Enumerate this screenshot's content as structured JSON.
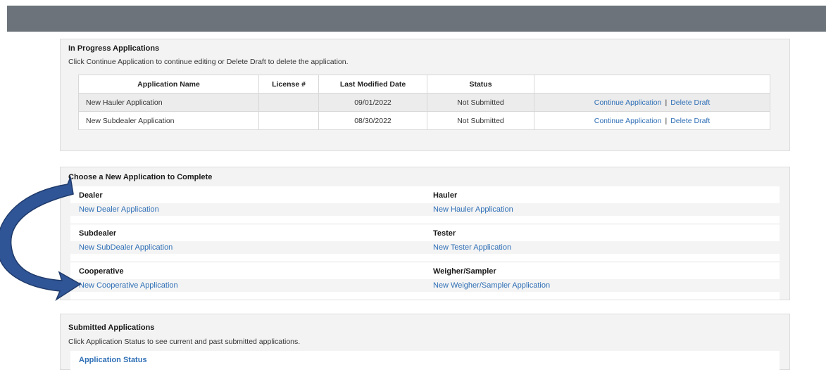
{
  "in_progress": {
    "title": "In Progress Applications",
    "description": "Click Continue Application to continue editing or Delete Draft to delete the application.",
    "columns": [
      "Application Name",
      "License #",
      "Last Modified Date",
      "Status",
      ""
    ],
    "rows": [
      {
        "name": "New Hauler Application",
        "license": "",
        "date": "09/01/2022",
        "status": "Not Submitted",
        "continue": "Continue Application",
        "separator": "|",
        "delete": "Delete Draft"
      },
      {
        "name": "New Subdealer Application",
        "license": "",
        "date": "08/30/2022",
        "status": "Not Submitted",
        "continue": "Continue Application",
        "separator": "|",
        "delete": "Delete Draft"
      }
    ]
  },
  "choose_new": {
    "title": "Choose a New Application to Complete",
    "groups": [
      {
        "left_name": "Dealer",
        "left_link": "New Dealer Application",
        "right_name": "Hauler",
        "right_link": "New Hauler Application"
      },
      {
        "left_name": "Subdealer",
        "left_link": "New SubDealer Application",
        "right_name": "Tester",
        "right_link": "New Tester Application"
      },
      {
        "left_name": "Cooperative",
        "left_link": "New Cooperative Application",
        "right_name": "Weigher/Sampler",
        "right_link": "New Weigher/Sampler Application"
      }
    ]
  },
  "submitted": {
    "title": "Submitted Applications",
    "description": "Click Application Status to see current and past submitted applications.",
    "status_link": "Application Status"
  },
  "colors": {
    "topbar": "#6c737a",
    "link": "#2f6fb6",
    "arrow_fill": "#2f5597",
    "arrow_stroke": "#1f3a6a"
  }
}
